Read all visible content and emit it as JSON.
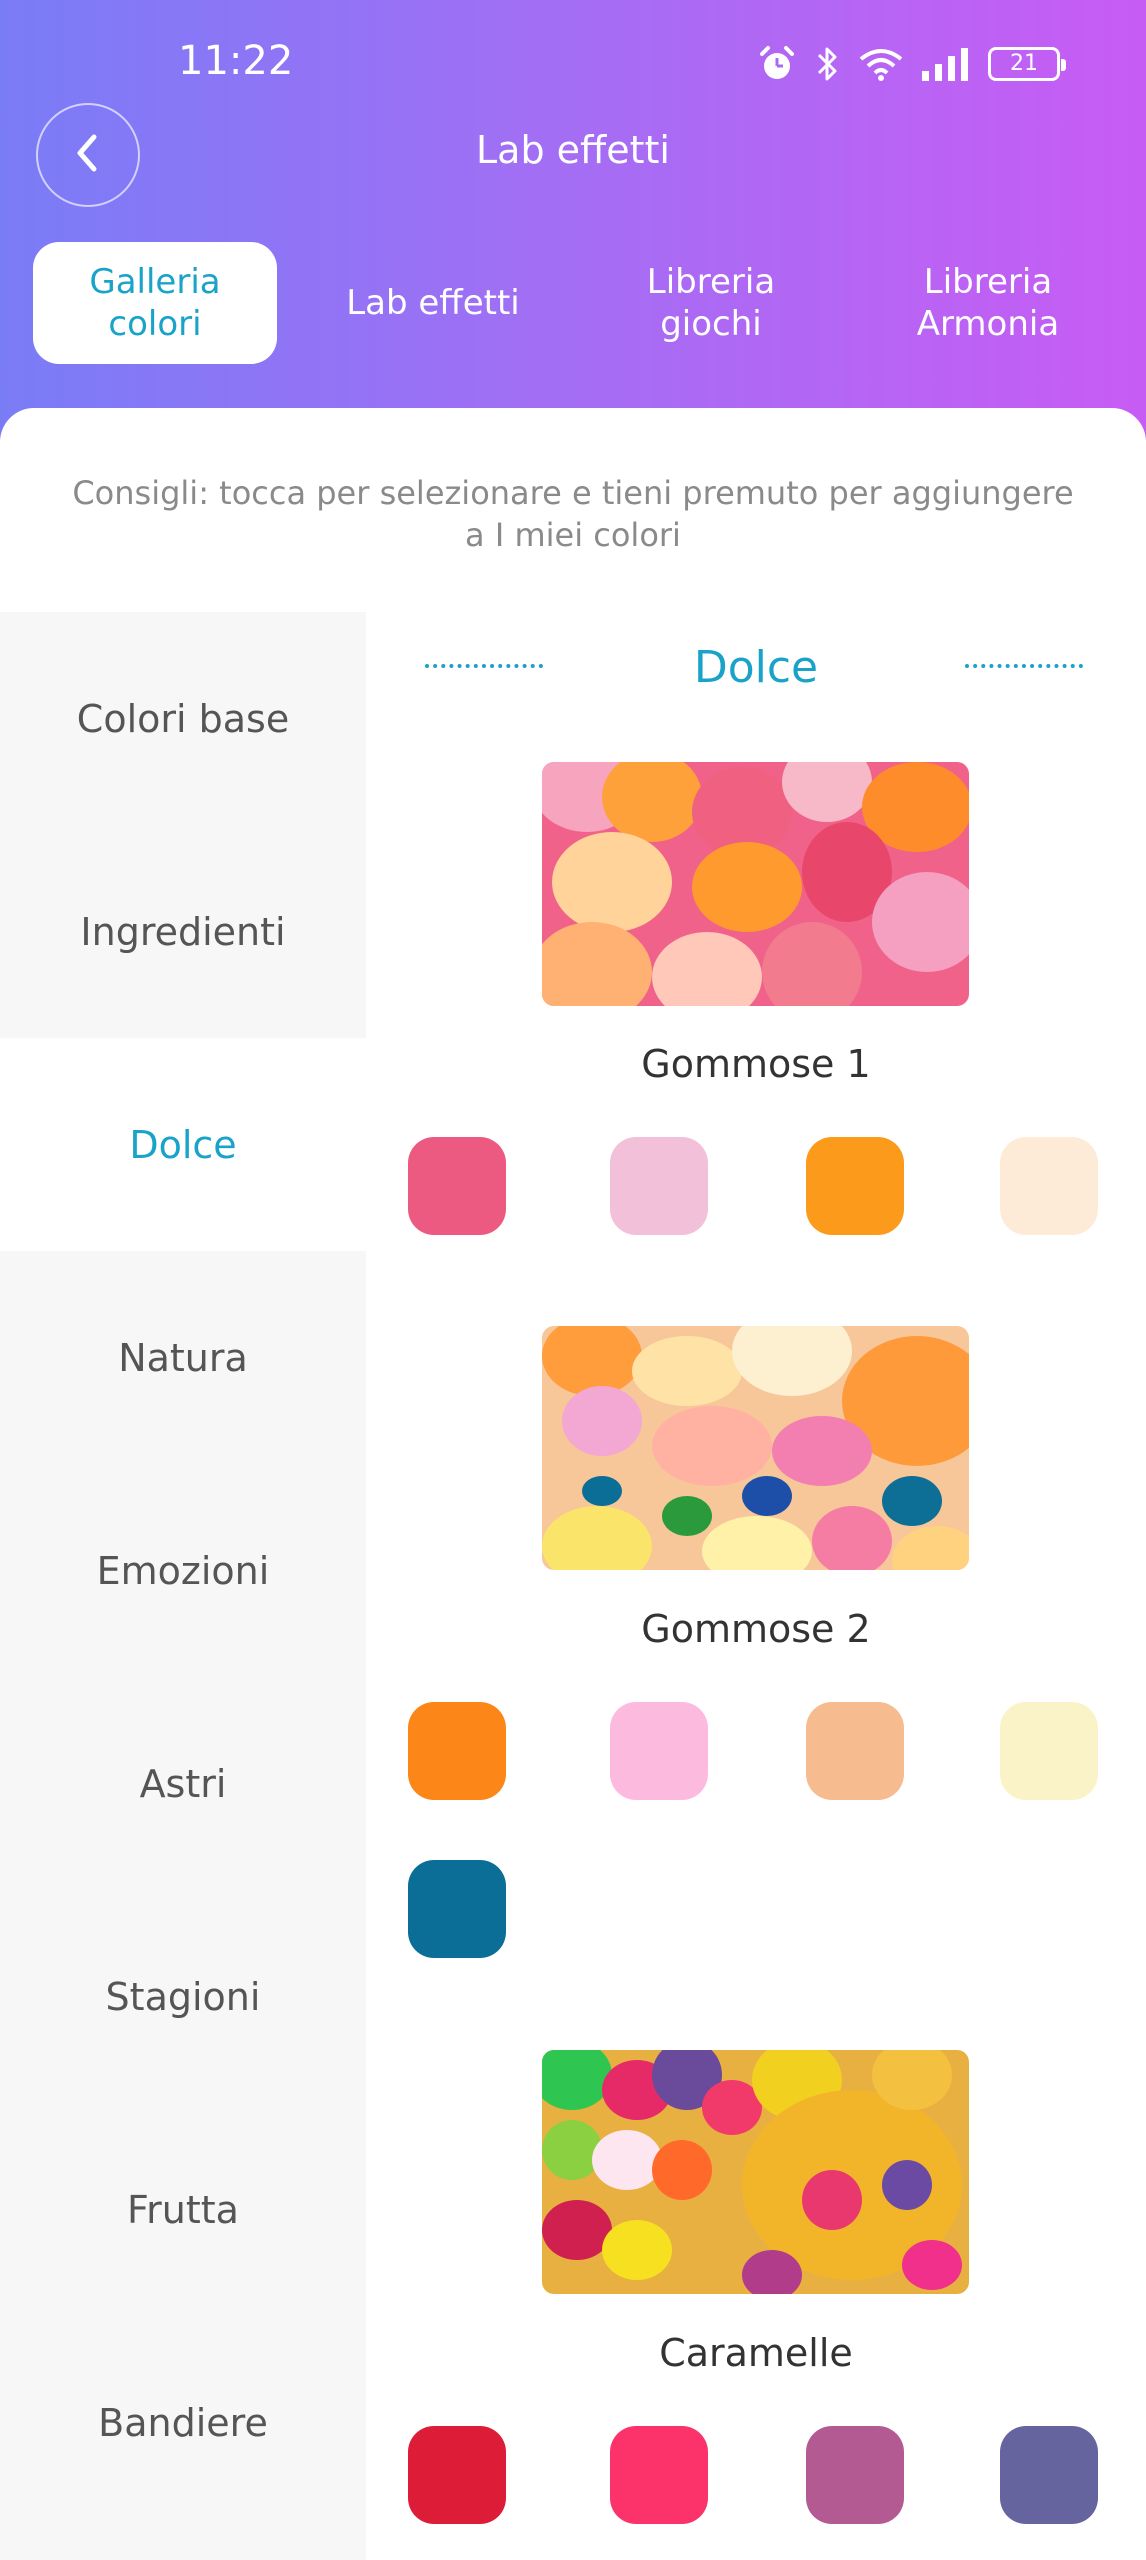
{
  "status": {
    "time": "11:22",
    "battery": "21",
    "icons": [
      "alarm-icon",
      "bluetooth-icon",
      "wifi-icon",
      "signal-icon",
      "battery-icon"
    ]
  },
  "header": {
    "title": "Lab effetti",
    "back_icon": "chevron-left-icon"
  },
  "tabs": [
    {
      "label": "Galleria\ncolori",
      "active": true
    },
    {
      "label": "Lab effetti",
      "active": false
    },
    {
      "label": "Libreria\ngiochi",
      "active": false
    },
    {
      "label": "Libreria\nArmonia",
      "active": false
    }
  ],
  "hint": "Consigli: tocca per selezionare e tieni premuto per aggiungere a I miei colori",
  "sidebar": {
    "items": [
      {
        "label": "Colori base"
      },
      {
        "label": "Ingredienti"
      },
      {
        "label": "Dolce"
      },
      {
        "label": "Natura"
      },
      {
        "label": "Emozioni"
      },
      {
        "label": "Astri"
      },
      {
        "label": "Stagioni"
      },
      {
        "label": "Frutta"
      },
      {
        "label": "Bandiere"
      }
    ],
    "selected": "Dolce"
  },
  "section": {
    "title": "Dolce"
  },
  "palettes": [
    {
      "name": "Gommose 1",
      "colors": [
        "#ec5a82",
        "#f2c0d8",
        "#fc9a1c",
        "#fdebd8"
      ]
    },
    {
      "name": "Gommose 2",
      "colors": [
        "#fc8718",
        "#fdbadf",
        "#f7bb90",
        "#fbf3c8",
        "#0b6e97"
      ]
    },
    {
      "name": "Caramelle",
      "colors": [
        "#dd1d37",
        "#fc336a",
        "#b45a93",
        "#66649e"
      ]
    }
  ],
  "accent_color": "#1aa3c9"
}
